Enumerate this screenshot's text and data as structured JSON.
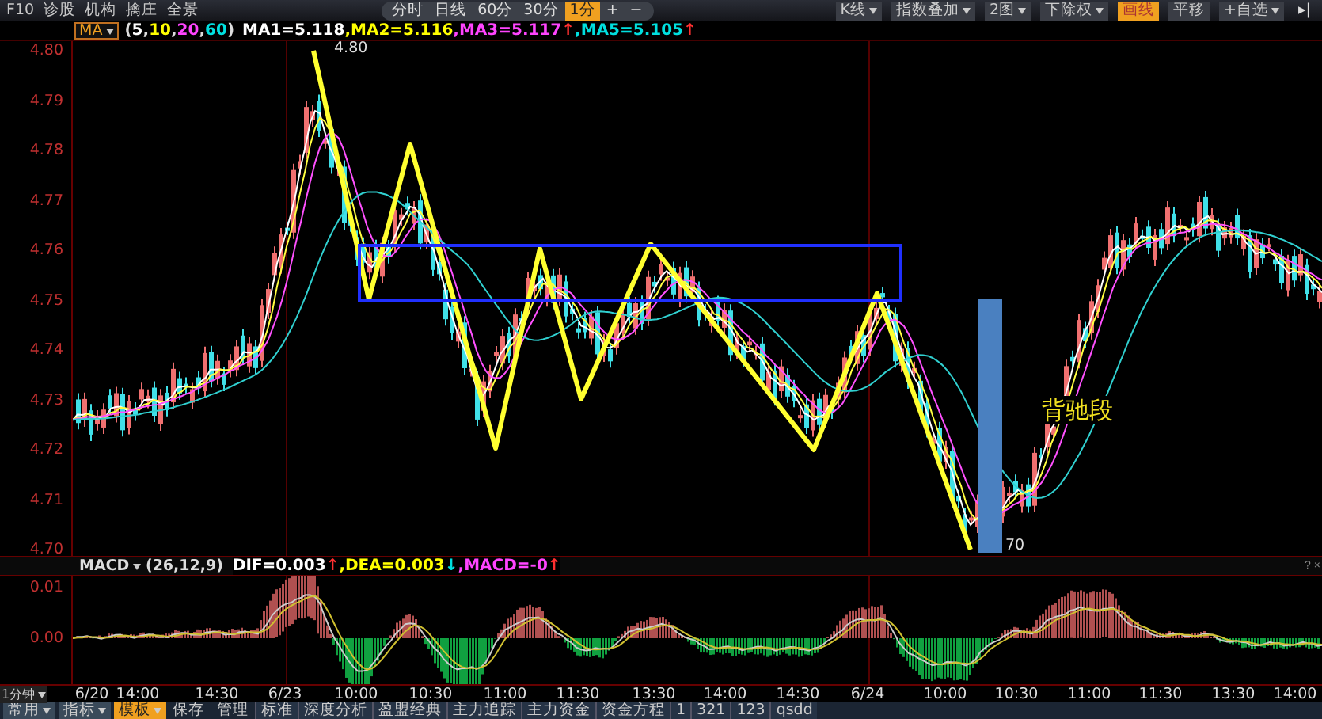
{
  "toolbar": {
    "left_items": [
      "F10",
      "诊股",
      "机构",
      "擒庄",
      "全景"
    ],
    "periods": [
      {
        "label": "分时",
        "selected": false
      },
      {
        "label": "日线",
        "selected": false
      },
      {
        "label": "60分",
        "selected": false
      },
      {
        "label": "30分",
        "selected": false
      },
      {
        "label": "1分",
        "selected": true
      }
    ],
    "zoom_buttons": [
      "+",
      "−"
    ],
    "right_items": [
      {
        "label": "K线",
        "dropdown": true,
        "selected": false
      },
      {
        "label": "指数叠加",
        "dropdown": true,
        "selected": false
      },
      {
        "label": "2图",
        "dropdown": true,
        "selected": false
      },
      {
        "label": "下除权",
        "dropdown": true,
        "selected": false
      },
      {
        "label": "画线",
        "dropdown": false,
        "selected": true
      },
      {
        "label": "平移",
        "dropdown": false,
        "selected": false
      },
      {
        "label": "+自选",
        "dropdown": true,
        "selected": false
      }
    ],
    "end_button": "▸|"
  },
  "ma_legend": {
    "indicator": "MA",
    "params": [
      {
        "text": "(",
        "color": "#dddddd"
      },
      {
        "text": "5",
        "color": "#ffffff"
      },
      {
        "text": ",",
        "color": "#dddddd"
      },
      {
        "text": "10",
        "color": "#ffff00"
      },
      {
        "text": ",",
        "color": "#dddddd"
      },
      {
        "text": "20",
        "color": "#ff44ff"
      },
      {
        "text": ",",
        "color": "#dddddd"
      },
      {
        "text": "60",
        "color": "#00e0e0"
      },
      {
        "text": ")",
        "color": "#dddddd"
      }
    ],
    "values": [
      {
        "text": "MA1=5.118",
        "kind": "ma1"
      },
      {
        "text": ",MA2=5.116",
        "kind": "ma2"
      },
      {
        "text": ",MA3=5.117",
        "kind": "ma3"
      },
      {
        "text": "↑",
        "kind": "up"
      },
      {
        "text": ",MA5=5.105",
        "kind": "ma5"
      },
      {
        "text": "↑",
        "kind": "up"
      }
    ]
  },
  "price_chart": {
    "y_labels": [
      "4.80",
      "4.79",
      "4.78",
      "4.77",
      "4.76",
      "4.75",
      "4.74",
      "4.73",
      "4.72",
      "4.71",
      "4.70"
    ],
    "high_label": "4.80",
    "low_label": "70",
    "annotation": "背驰段"
  },
  "macd_legend": {
    "indicator": "MACD",
    "params": "(26,12,9)",
    "values": [
      {
        "text": "DIF=0.003",
        "kind": "dif"
      },
      {
        "text": "↑",
        "kind": "up"
      },
      {
        "text": ",DEA=0.003",
        "kind": "dea"
      },
      {
        "text": "↓",
        "kind": "down"
      },
      {
        "text": ",MACD=-0",
        "kind": "macd"
      },
      {
        "text": "↑",
        "kind": "up"
      }
    ],
    "panel_buttons": [
      "?",
      "×"
    ]
  },
  "macd_chart": {
    "y_labels": [
      "0.01",
      "0.00"
    ]
  },
  "time_axis": {
    "period": "1分钟",
    "labels": [
      "6/20",
      "14:00",
      "14:30",
      "6/23",
      "10:00",
      "10:30",
      "11:00",
      "11:30",
      "13:30",
      "14:00",
      "14:30",
      "6/24",
      "10:00",
      "10:30",
      "11:00",
      "11:30",
      "13:30",
      "14:00"
    ]
  },
  "bottom_tabs": {
    "menus": [
      {
        "label": "常用",
        "selected": false
      },
      {
        "label": "指标",
        "selected": false
      },
      {
        "label": "模板",
        "selected": true
      }
    ],
    "actions": [
      "保存",
      "管理"
    ],
    "templates": [
      "标准",
      "深度分析",
      "盈盟经典",
      "主力追踪",
      "主力资金",
      "资金方程",
      "1",
      "321",
      "123",
      "qsdd"
    ]
  }
}
